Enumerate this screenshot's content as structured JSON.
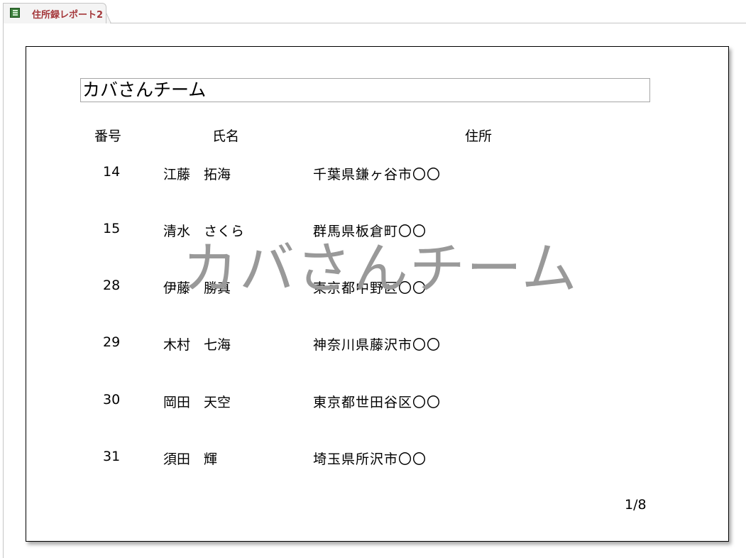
{
  "tab": {
    "title": "住所録レポート2",
    "icon": "report-icon"
  },
  "report": {
    "title": "カバさんチーム",
    "watermark": "カバさんチーム",
    "headers": {
      "number": "番号",
      "name": "氏名",
      "address": "住所"
    },
    "rows": [
      {
        "number": "14",
        "name": "江藤　拓海",
        "address": "千葉県鎌ヶ谷市〇〇"
      },
      {
        "number": "15",
        "name": "清水　さくら",
        "address": "群馬県板倉町〇〇"
      },
      {
        "number": "28",
        "name": "伊藤　勝真",
        "address": "東京都中野区〇〇"
      },
      {
        "number": "29",
        "name": "木村　七海",
        "address": "神奈川県藤沢市〇〇"
      },
      {
        "number": "30",
        "name": "岡田　天空",
        "address": "東京都世田谷区〇〇"
      },
      {
        "number": "31",
        "name": "須田　輝",
        "address": "埼玉県所沢市〇〇"
      }
    ],
    "page_indicator": "1/8"
  }
}
